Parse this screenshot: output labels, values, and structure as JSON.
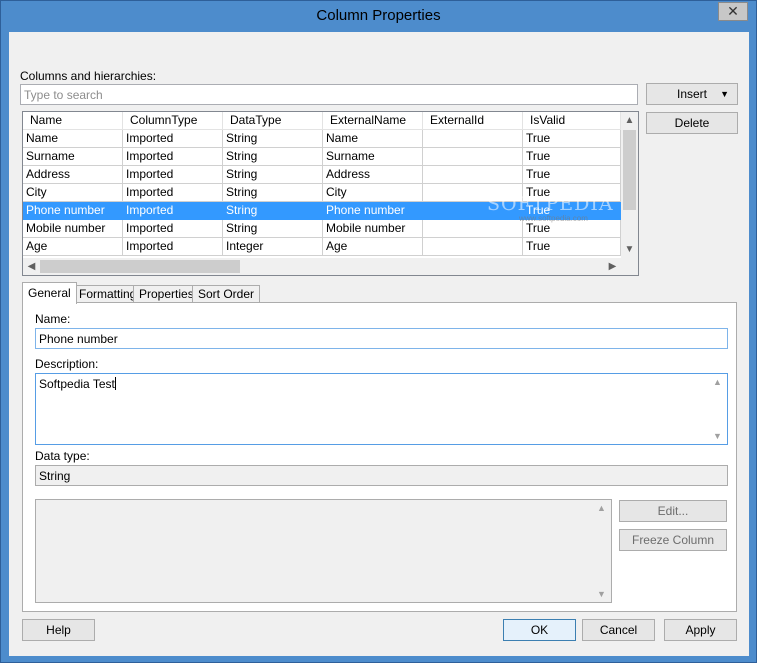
{
  "window": {
    "title": "Column Properties",
    "close_glyph": "✕"
  },
  "columns_label": "Columns and hierarchies:",
  "search": {
    "placeholder": "Type to search"
  },
  "buttons": {
    "insert": "Insert",
    "insert_arrow": "▼",
    "delete": "Delete",
    "edit": "Edit...",
    "freeze_column": "Freeze Column",
    "help": "Help",
    "ok": "OK",
    "cancel": "Cancel",
    "apply": "Apply"
  },
  "grid": {
    "headers": [
      "Name",
      "ColumnType",
      "DataType",
      "ExternalName",
      "ExternalId",
      "IsValid"
    ],
    "rows": [
      [
        "Name",
        "Imported",
        "String",
        "Name",
        "",
        "True"
      ],
      [
        "Surname",
        "Imported",
        "String",
        "Surname",
        "",
        "True"
      ],
      [
        "Address",
        "Imported",
        "String",
        "Address",
        "",
        "True"
      ],
      [
        "City",
        "Imported",
        "String",
        "City",
        "",
        "True"
      ],
      [
        "Phone number",
        "Imported",
        "String",
        "Phone number",
        "",
        "True"
      ],
      [
        "Mobile number",
        "Imported",
        "String",
        "Mobile number",
        "",
        "True"
      ],
      [
        "Age",
        "Imported",
        "Integer",
        "Age",
        "",
        "True"
      ]
    ],
    "selected_row": 4
  },
  "watermark": {
    "text": "SOFTPEDIA",
    "url": "www.softpedia.com"
  },
  "tabs": [
    "General",
    "Formatting",
    "Properties",
    "Sort Order"
  ],
  "general": {
    "name_label": "Name:",
    "name_value": "Phone number",
    "description_label": "Description:",
    "description_value": "Softpedia Test",
    "datatype_label": "Data type:",
    "datatype_value": "String"
  },
  "colors": {
    "selection": "#3399ff",
    "titlebar": "#4d8ccc",
    "focus_border": "#7eb4ea"
  }
}
